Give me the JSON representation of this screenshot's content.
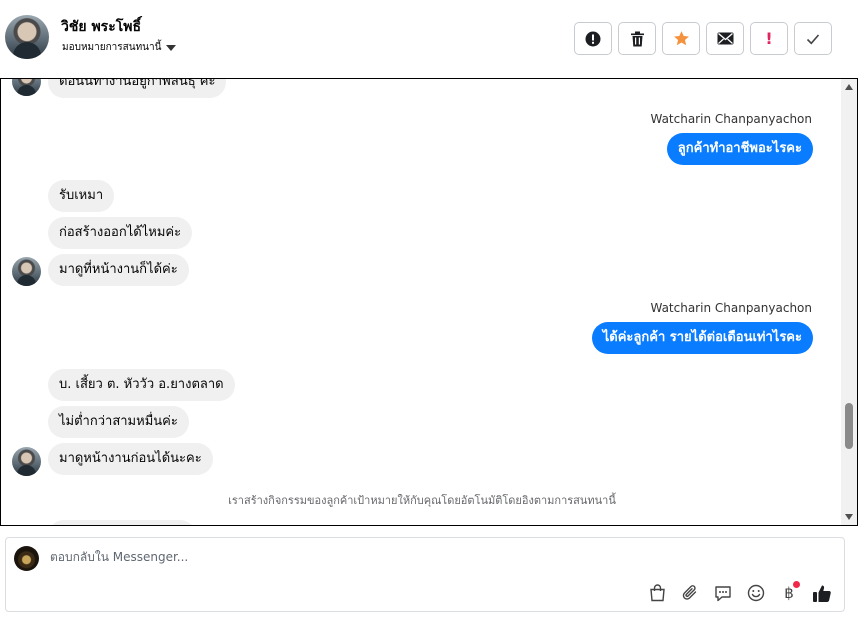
{
  "header": {
    "contact_name": "วิชัย พระโพธิ์",
    "assign_label": "มอบหมายการสนทนานี้"
  },
  "toolbar": {
    "buttons": [
      "mark-spam",
      "delete",
      "star",
      "unread",
      "important",
      "done"
    ]
  },
  "conversation": {
    "clipped_top_message": "ตอนนี้ทำงานอยู่กาฬสินธุ์ ค่ะ",
    "outgoing_1": {
      "sender": "Watcharin Chanpanyachon",
      "text": "ลูกค้าทำอาชีพอะไรคะ"
    },
    "incoming_group_1": [
      "รับเหมา",
      "ก่อสร้างออกได้ไหมค่ะ",
      "มาดูที่หน้างานก็ได้ค่ะ"
    ],
    "outgoing_2": {
      "sender": "Watcharin Chanpanyachon",
      "text": "ได้ค่ะลูกค้า รายได้ต่อเดือนเท่าไรคะ"
    },
    "incoming_group_2": [
      "บ. เสี้ยว ต. หัววัว อ.ยางตลาด",
      "ไม่ต่ำกว่าสามหมื่นค่ะ",
      "มาดูหน้างานก่อนได้นะคะ"
    ],
    "system_note": "เราสร้างกิจกรรมของลูกค้าเป้าหมายให้กับคุณโดยอัตโนมัติโดยอิงตามการสนทนานี้"
  },
  "composer": {
    "placeholder": "ตอบกลับใน Messenger...",
    "tools": [
      "shopping-bag",
      "attachment",
      "saved-replies",
      "emoji",
      "baht-payment",
      "like"
    ]
  },
  "colors": {
    "outgoing_bubble": "#0a7cff",
    "incoming_bubble": "#f0f0f0",
    "star": "#f5923e",
    "important": "#e0245e",
    "notification_dot": "#f02849"
  }
}
